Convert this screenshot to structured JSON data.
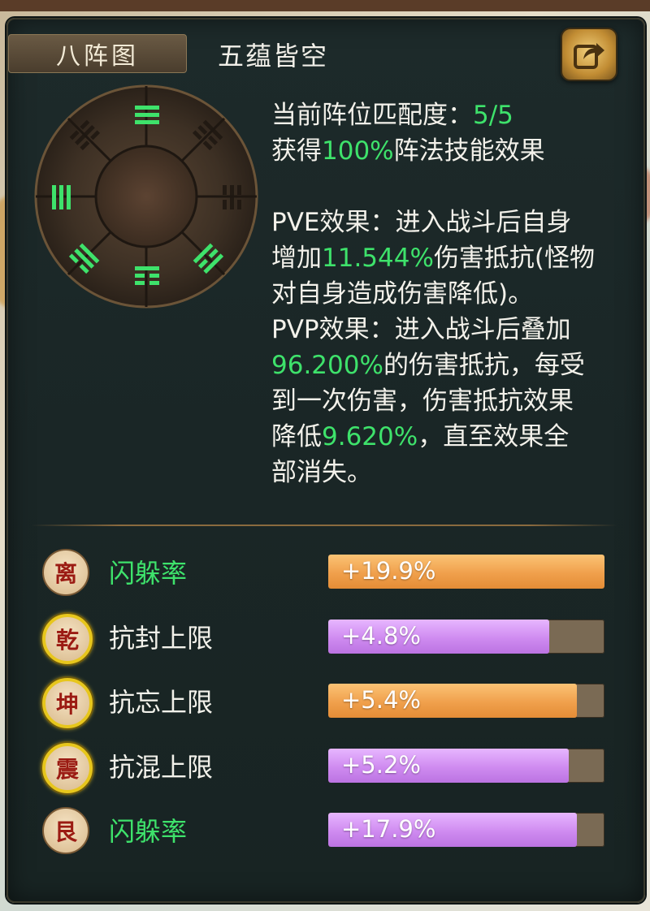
{
  "header": {
    "tab_label": "八阵图",
    "formation_name": "五蕴皆空"
  },
  "description": {
    "match_label": "当前阵位匹配度：",
    "match_value": "5/5",
    "gain_prefix": "获得",
    "gain_value": "100%",
    "gain_suffix": "阵法技能效果",
    "pve_line1": "PVE效果：进入战斗后自身",
    "pve_line2_prefix": "增加",
    "pve_value": "11.544%",
    "pve_line2_suffix": "伤害抵抗(怪物",
    "pve_line3": "对自身造成伤害降低)。",
    "pvp_line1": "PVP效果：进入战斗后叠加",
    "pvp_value": "96.200%",
    "pvp_line2_suffix": "的伤害抵抗，每受",
    "pvp_line3": "到一次伤害，伤害抵抗效果",
    "pvp_line4_prefix": "降低",
    "pvp_decay_value": "9.620%",
    "pvp_line4_suffix": "，直至效果全",
    "pvp_line5": "部消失。"
  },
  "attributes": [
    {
      "badge": "离",
      "name": "闪躲率",
      "value_text": "+19.9%",
      "fill": 1.0,
      "color": "orange",
      "name_green": true,
      "gold": false
    },
    {
      "badge": "乾",
      "name": "抗封上限",
      "value_text": "+4.8%",
      "fill": 0.8,
      "color": "purple",
      "name_green": false,
      "gold": true
    },
    {
      "badge": "坤",
      "name": "抗忘上限",
      "value_text": "+5.4%",
      "fill": 0.9,
      "color": "orange",
      "name_green": false,
      "gold": true
    },
    {
      "badge": "震",
      "name": "抗混上限",
      "value_text": "+5.2%",
      "fill": 0.87,
      "color": "purple",
      "name_green": false,
      "gold": true
    },
    {
      "badge": "艮",
      "name": "闪躲率",
      "value_text": "+17.9%",
      "fill": 0.9,
      "color": "purple",
      "name_green": true,
      "gold": false
    }
  ],
  "colors": {
    "accent_green": "#3ee26b",
    "bar_orange": "#f0a04c",
    "bar_purple": "#cf8bf0",
    "badge_gold_ring": "#e7c61c"
  },
  "icons": {
    "share": "share-arrow-icon",
    "wheel": "bagua-wheel-icon"
  }
}
